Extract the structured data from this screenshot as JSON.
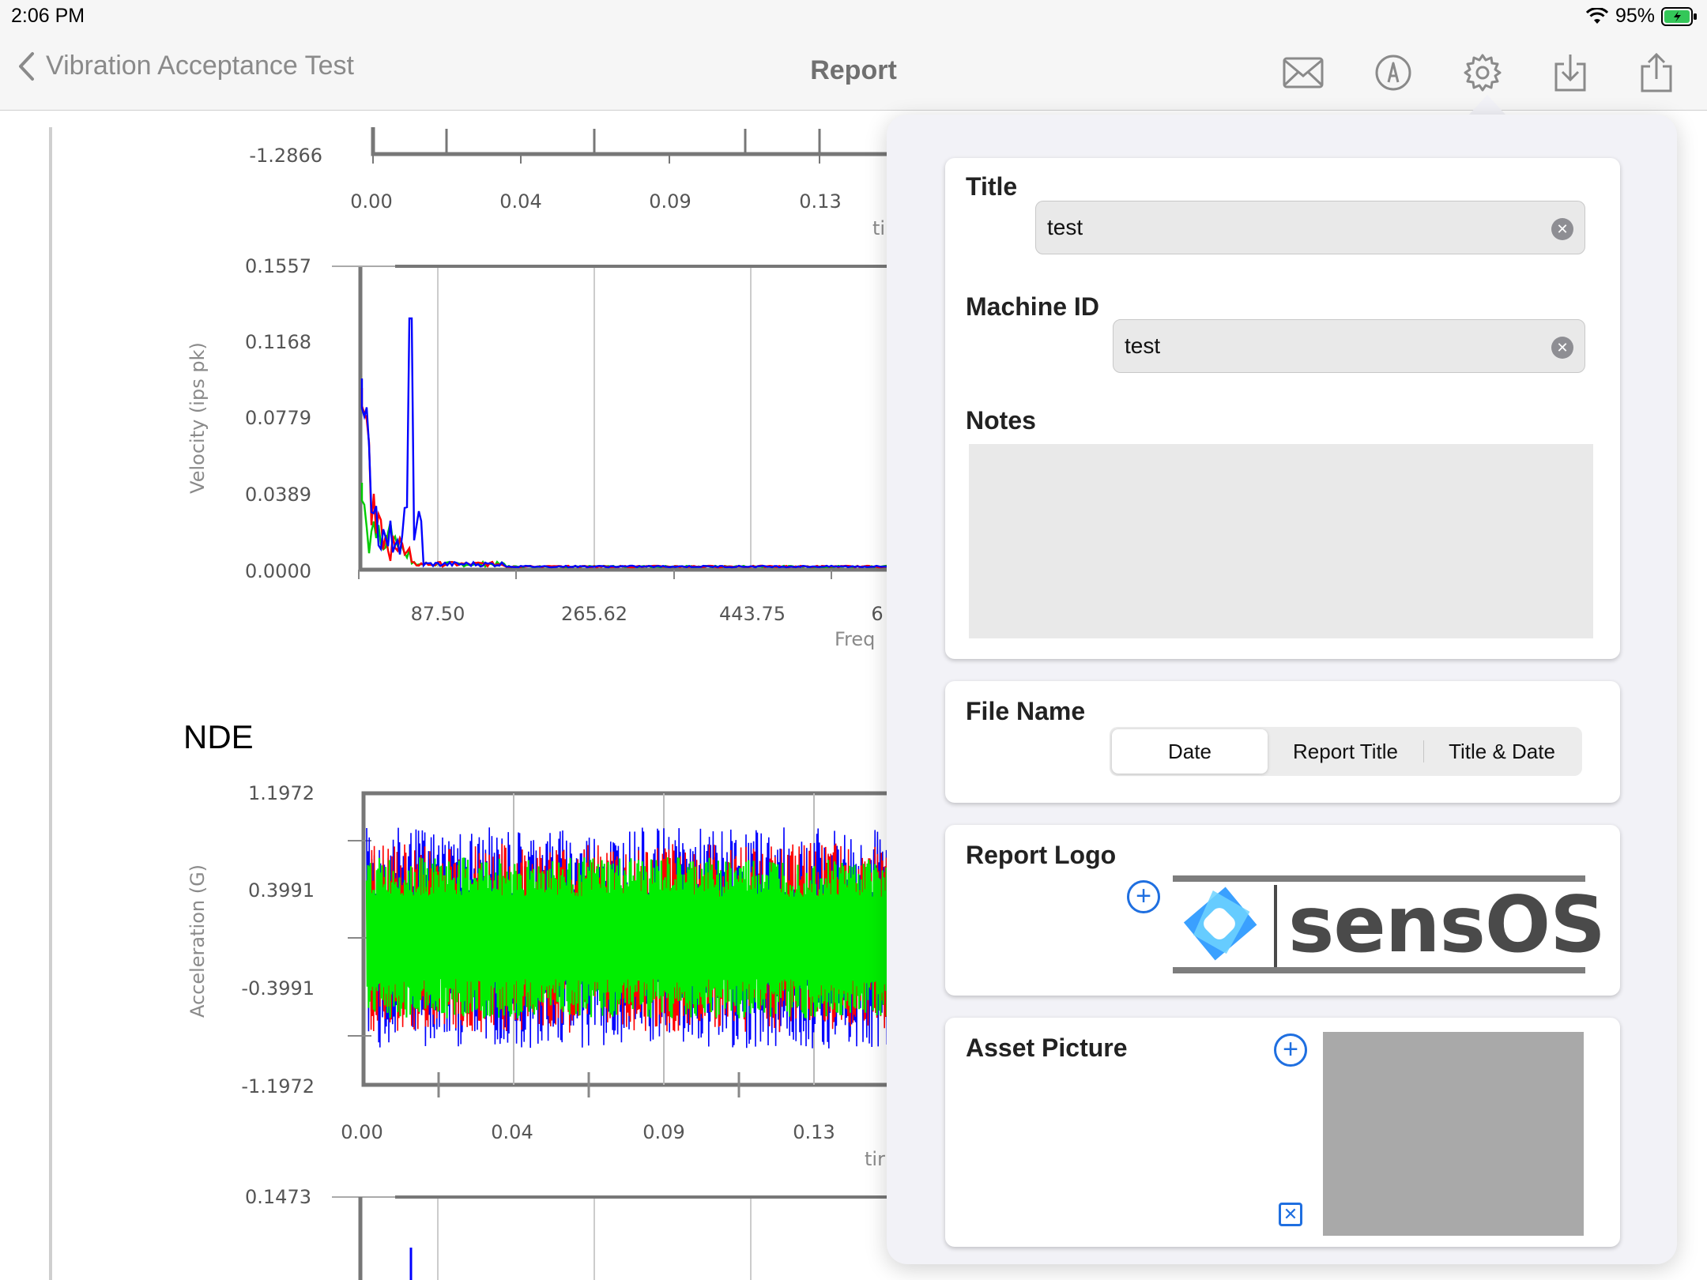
{
  "status": {
    "time": "2:06 PM",
    "battery": "95%"
  },
  "nav": {
    "back_label": "Vibration Acceptance Test",
    "title": "Report",
    "icons": [
      "mail-icon",
      "markup-icon",
      "gear-icon",
      "download-icon",
      "share-icon"
    ]
  },
  "report": {
    "section_title": "NDE",
    "chart_data": [
      {
        "type": "line",
        "partial": true,
        "y_ticks": [
          "-1.2866"
        ],
        "x_ticks": [
          "0.00",
          "0.04",
          "0.09",
          "0.13"
        ],
        "xlabel": "ti"
      },
      {
        "type": "line",
        "series_colors": [
          "#0000ff",
          "#ff0000",
          "#00cc00"
        ],
        "y_ticks": [
          "0.1557",
          "0.1168",
          "0.0779",
          "0.0389",
          "0.0000"
        ],
        "x_ticks": [
          "87.50",
          "265.62",
          "443.75",
          "6"
        ],
        "xlabel": "Freq",
        "ylabel": "Velocity (ips pk)",
        "ylim": [
          0,
          0.1557
        ]
      },
      {
        "type": "line",
        "series_colors": [
          "#0000ff",
          "#ff0000",
          "#00ee00"
        ],
        "y_ticks": [
          "1.1972",
          "0.3991",
          "-0.3991",
          "-1.1972"
        ],
        "x_ticks": [
          "0.00",
          "0.04",
          "0.09",
          "0.13"
        ],
        "xlabel": "tir",
        "ylabel": "Acceleration (G)",
        "ylim": [
          -1.1972,
          1.1972
        ]
      },
      {
        "type": "line",
        "partial": true,
        "y_ticks": [
          "0.1473"
        ]
      }
    ]
  },
  "form": {
    "title_label": "Title",
    "title_value": "test",
    "machine_label": "Machine ID",
    "machine_value": "test",
    "notes_label": "Notes",
    "notes_value": "",
    "file_name_label": "File Name",
    "file_name_options": [
      "Date",
      "Report Title",
      "Title & Date"
    ],
    "file_name_selected": "Date",
    "logo_label": "Report Logo",
    "logo_text": "sensOS",
    "asset_label": "Asset Picture"
  },
  "colors": {
    "accent": "#1f6fe0",
    "battery": "#34c759"
  }
}
